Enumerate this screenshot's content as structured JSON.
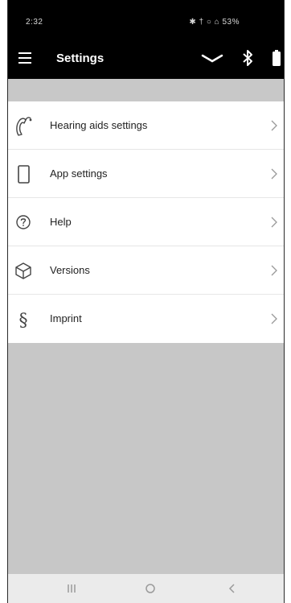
{
  "status_bar": {
    "time": "2:32",
    "right_text": "✱ † ○ ⌂ 53%"
  },
  "app_bar": {
    "title": "Settings",
    "icons": [
      "menu-icon",
      "chevron-down-icon",
      "bluetooth-icon",
      "battery-icon"
    ]
  },
  "settings_list": {
    "items": [
      {
        "label": "Hearing aids settings",
        "icon": "hearing-aid-icon"
      },
      {
        "label": "App settings",
        "icon": "phone-icon"
      },
      {
        "label": "Help",
        "icon": "help-icon"
      },
      {
        "label": "Versions",
        "icon": "cube-icon"
      },
      {
        "label": "Imprint",
        "icon": "section-sign-icon"
      }
    ]
  },
  "nav_bar": {
    "icons": [
      "recent-apps-icon",
      "home-icon",
      "back-icon"
    ]
  },
  "colors": {
    "app_bar": "#000000",
    "background": "#c7c7c7",
    "list_background": "#ffffff",
    "text": "#222222"
  }
}
